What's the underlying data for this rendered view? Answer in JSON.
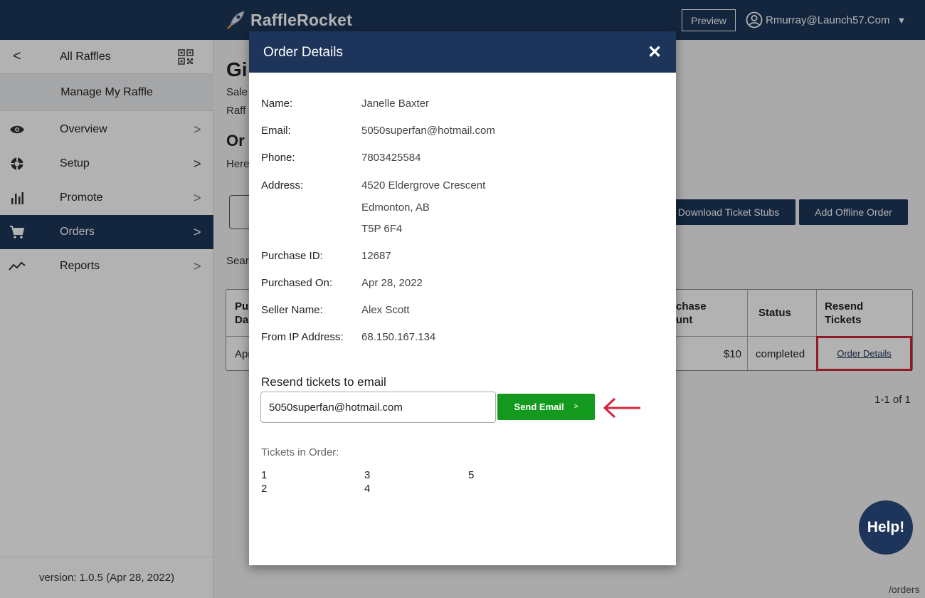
{
  "header": {
    "logo_text": "RaffleRocket",
    "preview_label": "Preview",
    "user_email": "Rmurray@Launch57.Com"
  },
  "sidebar": {
    "back_label": "All Raffles",
    "manage_label": "Manage My Raffle",
    "items": [
      {
        "label": "Overview",
        "icon": "eye-icon"
      },
      {
        "label": "Setup",
        "icon": "gear-icon"
      },
      {
        "label": "Promote",
        "icon": "bar-chart-icon"
      },
      {
        "label": "Orders",
        "icon": "cart-icon",
        "active": true
      },
      {
        "label": "Reports",
        "icon": "trend-line-icon"
      }
    ],
    "version": "version: 1.0.5 (Apr 28, 2022)"
  },
  "main": {
    "title": "Gi",
    "sub1": "Sale",
    "sub2": "Raff",
    "section_title": "Or",
    "here_text": "Here",
    "search_label": "Sear",
    "download_button": "Download Ticket Stubs",
    "add_order_button": "Add Offline Order",
    "table": {
      "col1_header": "Pu\nDa",
      "col_amount_header": "chase\nunt",
      "col_status_header": "Status",
      "col_resend_header": "Resend\nTickets",
      "row_date": "Apr",
      "row_amount": "$10",
      "row_status": "completed",
      "row_link": "Order Details"
    },
    "pager": "1-1 of 1",
    "help": "Help!",
    "path": "/orders"
  },
  "modal": {
    "title": "Order Details",
    "close": "✕",
    "fields": [
      {
        "label": "Name:",
        "value": "Janelle Baxter"
      },
      {
        "label": "Email:",
        "value": "5050superfan@hotmail.com"
      },
      {
        "label": "Phone:",
        "value": "7803425584"
      },
      {
        "label": "Address:",
        "value": "4520 Eldergrove Crescent"
      },
      {
        "label": "",
        "value": "Edmonton, AB"
      },
      {
        "label": "",
        "value": "T5P 6F4"
      },
      {
        "label": "Purchase ID:",
        "value": "12687"
      },
      {
        "label": "Purchased On:",
        "value": "Apr 28, 2022"
      },
      {
        "label": "Seller Name:",
        "value": "Alex Scott"
      },
      {
        "label": "From IP Address:",
        "value": "68.150.167.134"
      }
    ],
    "resend_label": "Resend tickets to email",
    "resend_value": "5050superfan@hotmail.com",
    "send_button": "Send Email",
    "send_arrow": ">",
    "tickets_label": "Tickets in Order:",
    "tickets": [
      "1",
      "2",
      "3",
      "4",
      "5"
    ]
  },
  "colors": {
    "navy": "#1d355a",
    "send_green": "#139a1e",
    "annotation_red": "#d0263a"
  }
}
